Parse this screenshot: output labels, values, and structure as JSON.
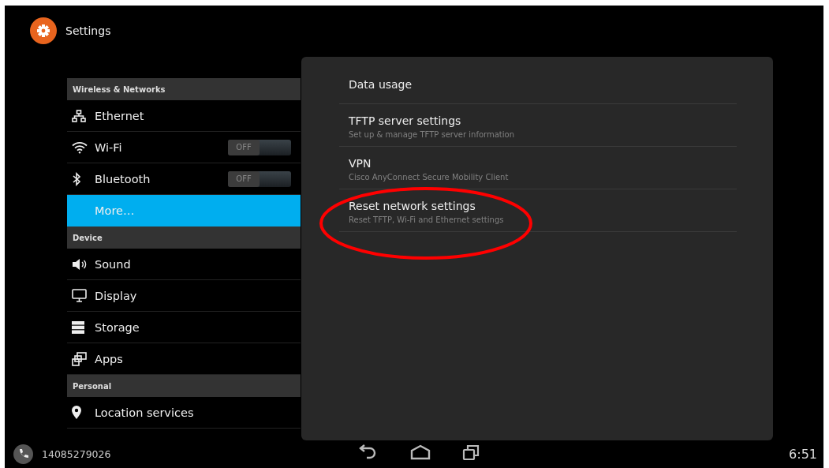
{
  "header": {
    "title": "Settings"
  },
  "sidebar": {
    "sections": [
      {
        "title": "Wireless & Networks",
        "items": [
          {
            "label": "Ethernet",
            "kind": "plain",
            "selected": false
          },
          {
            "label": "Wi-Fi",
            "kind": "toggle",
            "on": false,
            "toggle_text": "OFF",
            "selected": false
          },
          {
            "label": "Bluetooth",
            "kind": "toggle",
            "on": false,
            "toggle_text": "OFF",
            "selected": false
          },
          {
            "label": "More…",
            "kind": "plain",
            "selected": true
          }
        ]
      },
      {
        "title": "Device",
        "items": [
          {
            "label": "Sound",
            "kind": "plain",
            "selected": false
          },
          {
            "label": "Display",
            "kind": "plain",
            "selected": false
          },
          {
            "label": "Storage",
            "kind": "plain",
            "selected": false
          },
          {
            "label": "Apps",
            "kind": "plain",
            "selected": false
          }
        ]
      },
      {
        "title": "Personal",
        "items": [
          {
            "label": "Location services",
            "kind": "plain",
            "selected": false
          }
        ]
      }
    ]
  },
  "panel": {
    "items": [
      {
        "title": "Data usage"
      },
      {
        "title": "TFTP server settings",
        "summary": "Set up & manage TFTP server information"
      },
      {
        "title": "VPN",
        "summary": "Cisco AnyConnect Secure Mobility Client"
      },
      {
        "title": "Reset network settings",
        "summary": "Reset TFTP, Wi-Fi and Ethernet settings"
      }
    ]
  },
  "annotation": {
    "kind": "ellipse"
  },
  "status_bar": {
    "phone_number": "14085279026",
    "time": "6:51"
  }
}
